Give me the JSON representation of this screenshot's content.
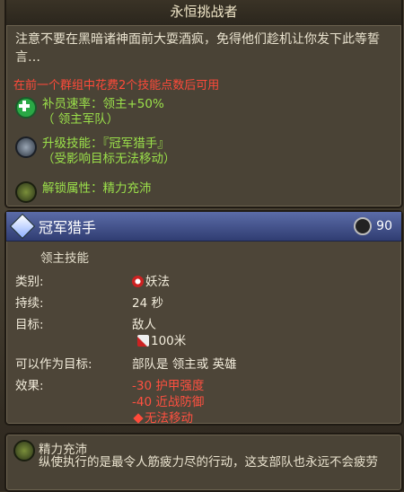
{
  "header": {
    "title": "永恒挑战者"
  },
  "description": "注意不要在黑暗诸神面前大耍酒疯，免得他们趁机让你发下此等誓言…",
  "requirement": "在前一个群组中花费2个技能点数后可用",
  "effects": [
    {
      "icon": "plus-icon",
      "line1": "补员速率：领主+50%",
      "line2": "（ 领主军队）"
    },
    {
      "icon": "upgrade-icon",
      "line1": "升级技能：『冠军猎手』",
      "line2": "（受影响目标无法移动）"
    },
    {
      "icon": "attribute-icon",
      "line1": "解锁属性：精力充沛"
    }
  ],
  "ability": {
    "name": "冠军猎手",
    "cost": "90",
    "type": "领主技能",
    "rows": [
      {
        "label": "类别:",
        "value": "妖法"
      },
      {
        "label": "持续:",
        "value": "24 秒"
      },
      {
        "label": "目标:",
        "value": "敌人",
        "value2": "100米"
      },
      {
        "label": "可以作为目标:",
        "value": "部队是 领主或 英雄"
      },
      {
        "label": "效果:",
        "value": "-30  护甲强度",
        "value2": "-40  近战防御",
        "value3": "无法移动"
      }
    ]
  },
  "attribute": {
    "title": "精力充沛",
    "text": "纵使执行的是最令人筋疲力尽的行动，这支部队也永远不会疲劳"
  },
  "colors": {
    "green": "#9be04a",
    "red": "#ff4a3a",
    "ability_bar": "#303d72"
  }
}
